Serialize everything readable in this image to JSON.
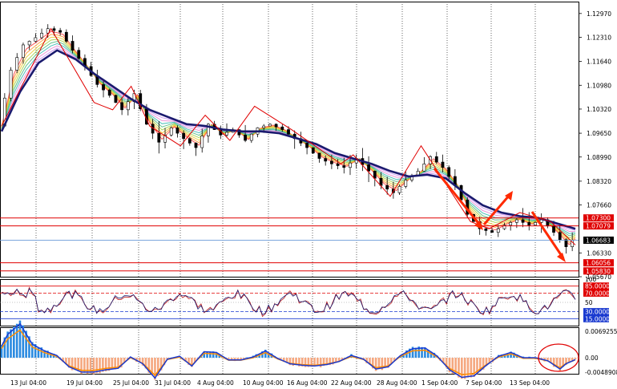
{
  "colors": {
    "background": "#ffffff",
    "candle": "#000000",
    "ema_slow": "#1a1a6e",
    "zigzag": "#e00000",
    "level_line": "#e00000",
    "price_line": "#6a9ad8",
    "arrow": "#ff2a00",
    "rsi_line": "#1a1a6e",
    "rsi_line2": "#c02020",
    "osc_line_blue": "#1a3ad0",
    "osc_line_orange": "#ff8c00",
    "hist_pos": "#2a8ae0",
    "hist_neg": "#f5a77f",
    "grid": "#000000"
  },
  "chart_data": [
    {
      "type": "line",
      "title": "",
      "y_ticks": [
        "1.12970",
        "1.12310",
        "1.11640",
        "1.10980",
        "1.10320",
        "1.09650",
        "1.08990",
        "1.08320",
        "1.07660",
        "1.06330",
        "1.05670"
      ],
      "y_range": [
        1.0567,
        1.133
      ],
      "current_price": "1.06683",
      "levels": [
        {
          "label": "1.07300",
          "value": 1.073
        },
        {
          "label": "1.07079",
          "value": 1.07079
        },
        {
          "label": "1.06056",
          "value": 1.06056
        },
        {
          "label": "1.05830",
          "value": 1.0583
        }
      ],
      "x_labels": [
        "13 Jul 04:00",
        "19 Jul 04:00",
        "25 Jul 04:00",
        "31 Jul 04:00",
        "4 Aug 04:00",
        "10 Aug 04:00",
        "16 Aug 04:00",
        "22 Aug 04:00",
        "28 Aug 04:00",
        "1 Sep 04:00",
        "7 Sep 04:00",
        "13 Sep 04:00"
      ],
      "price_path": [
        [
          0,
          1.0985
        ],
        [
          2,
          1.114
        ],
        [
          4,
          1.121
        ],
        [
          6,
          1.123
        ],
        [
          8,
          1.1255
        ],
        [
          10,
          1.1245
        ],
        [
          12,
          1.1195
        ],
        [
          14,
          1.115
        ],
        [
          16,
          1.11
        ],
        [
          18,
          1.107
        ],
        [
          20,
          1.103
        ],
        [
          22,
          1.1075
        ],
        [
          24,
          1.099
        ],
        [
          26,
          1.094
        ],
        [
          28,
          1.098
        ],
        [
          30,
          1.095
        ],
        [
          32,
          1.0925
        ],
        [
          34,
          1.099
        ],
        [
          36,
          1.096
        ],
        [
          38,
          1.0975
        ],
        [
          40,
          1.0945
        ],
        [
          42,
          1.098
        ],
        [
          44,
          1.099
        ],
        [
          46,
          1.0975
        ],
        [
          48,
          1.095
        ],
        [
          50,
          1.0925
        ],
        [
          52,
          1.0895
        ],
        [
          54,
          1.088
        ],
        [
          56,
          1.087
        ],
        [
          58,
          1.0895
        ],
        [
          60,
          1.086
        ],
        [
          62,
          1.082
        ],
        [
          64,
          1.08
        ],
        [
          66,
          1.0835
        ],
        [
          68,
          1.086
        ],
        [
          70,
          1.09
        ],
        [
          72,
          1.087
        ],
        [
          74,
          1.082
        ],
        [
          76,
          1.074
        ],
        [
          78,
          1.07
        ],
        [
          80,
          1.069
        ],
        [
          82,
          1.071
        ],
        [
          84,
          1.0725
        ],
        [
          86,
          1.071
        ],
        [
          88,
          1.0725
        ],
        [
          90,
          1.069
        ],
        [
          92,
          1.065
        ],
        [
          93,
          1.0668
        ]
      ],
      "ema_slow_path": [
        [
          0,
          1.097
        ],
        [
          3,
          1.108
        ],
        [
          6,
          1.116
        ],
        [
          9,
          1.1195
        ],
        [
          12,
          1.117
        ],
        [
          15,
          1.113
        ],
        [
          18,
          1.1095
        ],
        [
          21,
          1.106
        ],
        [
          24,
          1.103
        ],
        [
          27,
          1.101
        ],
        [
          30,
          1.099
        ],
        [
          33,
          1.0985
        ],
        [
          36,
          1.0975
        ],
        [
          39,
          1.097
        ],
        [
          42,
          1.097
        ],
        [
          45,
          1.0965
        ],
        [
          48,
          1.095
        ],
        [
          51,
          1.0935
        ],
        [
          54,
          1.091
        ],
        [
          57,
          1.0895
        ],
        [
          60,
          1.088
        ],
        [
          63,
          1.086
        ],
        [
          66,
          1.0845
        ],
        [
          69,
          1.085
        ],
        [
          72,
          1.084
        ],
        [
          75,
          1.08
        ],
        [
          78,
          1.0765
        ],
        [
          81,
          1.0745
        ],
        [
          84,
          1.0735
        ],
        [
          87,
          1.073
        ],
        [
          90,
          1.0715
        ],
        [
          93,
          1.07
        ]
      ],
      "zigzag": [
        [
          0,
          1.0985
        ],
        [
          8,
          1.1255
        ],
        [
          15,
          1.105
        ],
        [
          18,
          1.103
        ],
        [
          21,
          1.1095
        ],
        [
          24,
          1.0985
        ],
        [
          29,
          1.093
        ],
        [
          33,
          1.1015
        ],
        [
          37,
          1.0945
        ],
        [
          41,
          1.104
        ],
        [
          47,
          1.0975
        ],
        [
          55,
          1.088
        ],
        [
          57,
          1.0905
        ],
        [
          63,
          1.079
        ],
        [
          68,
          1.093
        ],
        [
          76,
          1.072
        ],
        [
          79,
          1.07
        ],
        [
          84,
          1.0745
        ],
        [
          89,
          1.072
        ],
        [
          93,
          1.0655
        ]
      ]
    },
    {
      "type": "line",
      "title": "",
      "y_ticks": [
        "100",
        "85.0000",
        "70.0000",
        "50",
        "30.0000",
        "15.0000"
      ],
      "levels": [
        85,
        70,
        30,
        15
      ]
    },
    {
      "type": "bar",
      "title": "",
      "y_ticks": [
        "0.0069255",
        "0.00",
        "-0.0048908"
      ]
    }
  ]
}
